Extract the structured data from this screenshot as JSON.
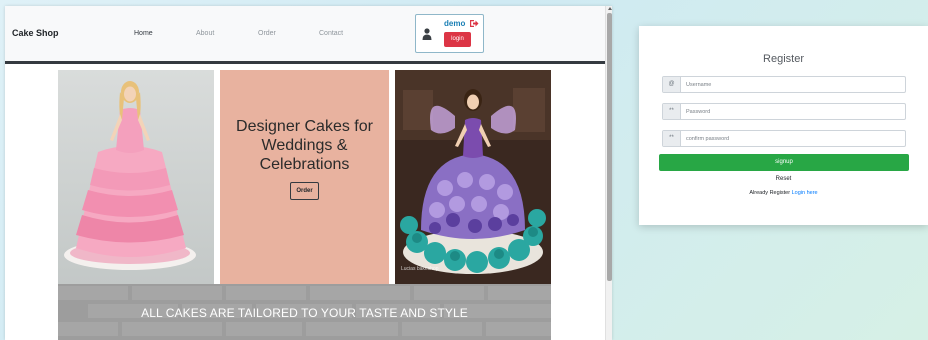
{
  "shop": {
    "brand": "Cake Shop",
    "nav": {
      "home": "Home",
      "about": "About",
      "order": "Order",
      "contact": "Contact"
    },
    "user": {
      "name": "demo",
      "login_label": "login",
      "icon": "user-icon",
      "logout_icon": "sign-out-icon"
    },
    "hero": {
      "headline_line1": "Designer Cakes for",
      "headline_line2": "Weddings &",
      "headline_line3": "Celebrations",
      "order_label": "Order",
      "left_image": "pink doll cake",
      "right_image": "purple fairy doll cake with cupcakes",
      "watermark": "Lucias bakeshop"
    },
    "banner": {
      "text": "ALL CAKES ARE TAILORED TO YOUR TASTE AND STYLE"
    }
  },
  "register": {
    "title": "Register",
    "username_placeholder": "Username",
    "password_placeholder": "Password",
    "confirm_placeholder": "confirm password",
    "username_icon": "@",
    "password_icon": "**",
    "confirm_icon": "**",
    "signup_label": "signup",
    "reset_label": "Reset",
    "already_text": "Already Register",
    "login_here": "Login here"
  },
  "colors": {
    "login_button": "#dc3545",
    "signup_button": "#28a745",
    "link": "#007bff",
    "hero_panel": "#e8b29f",
    "navbar_bottom": "#343a40"
  }
}
